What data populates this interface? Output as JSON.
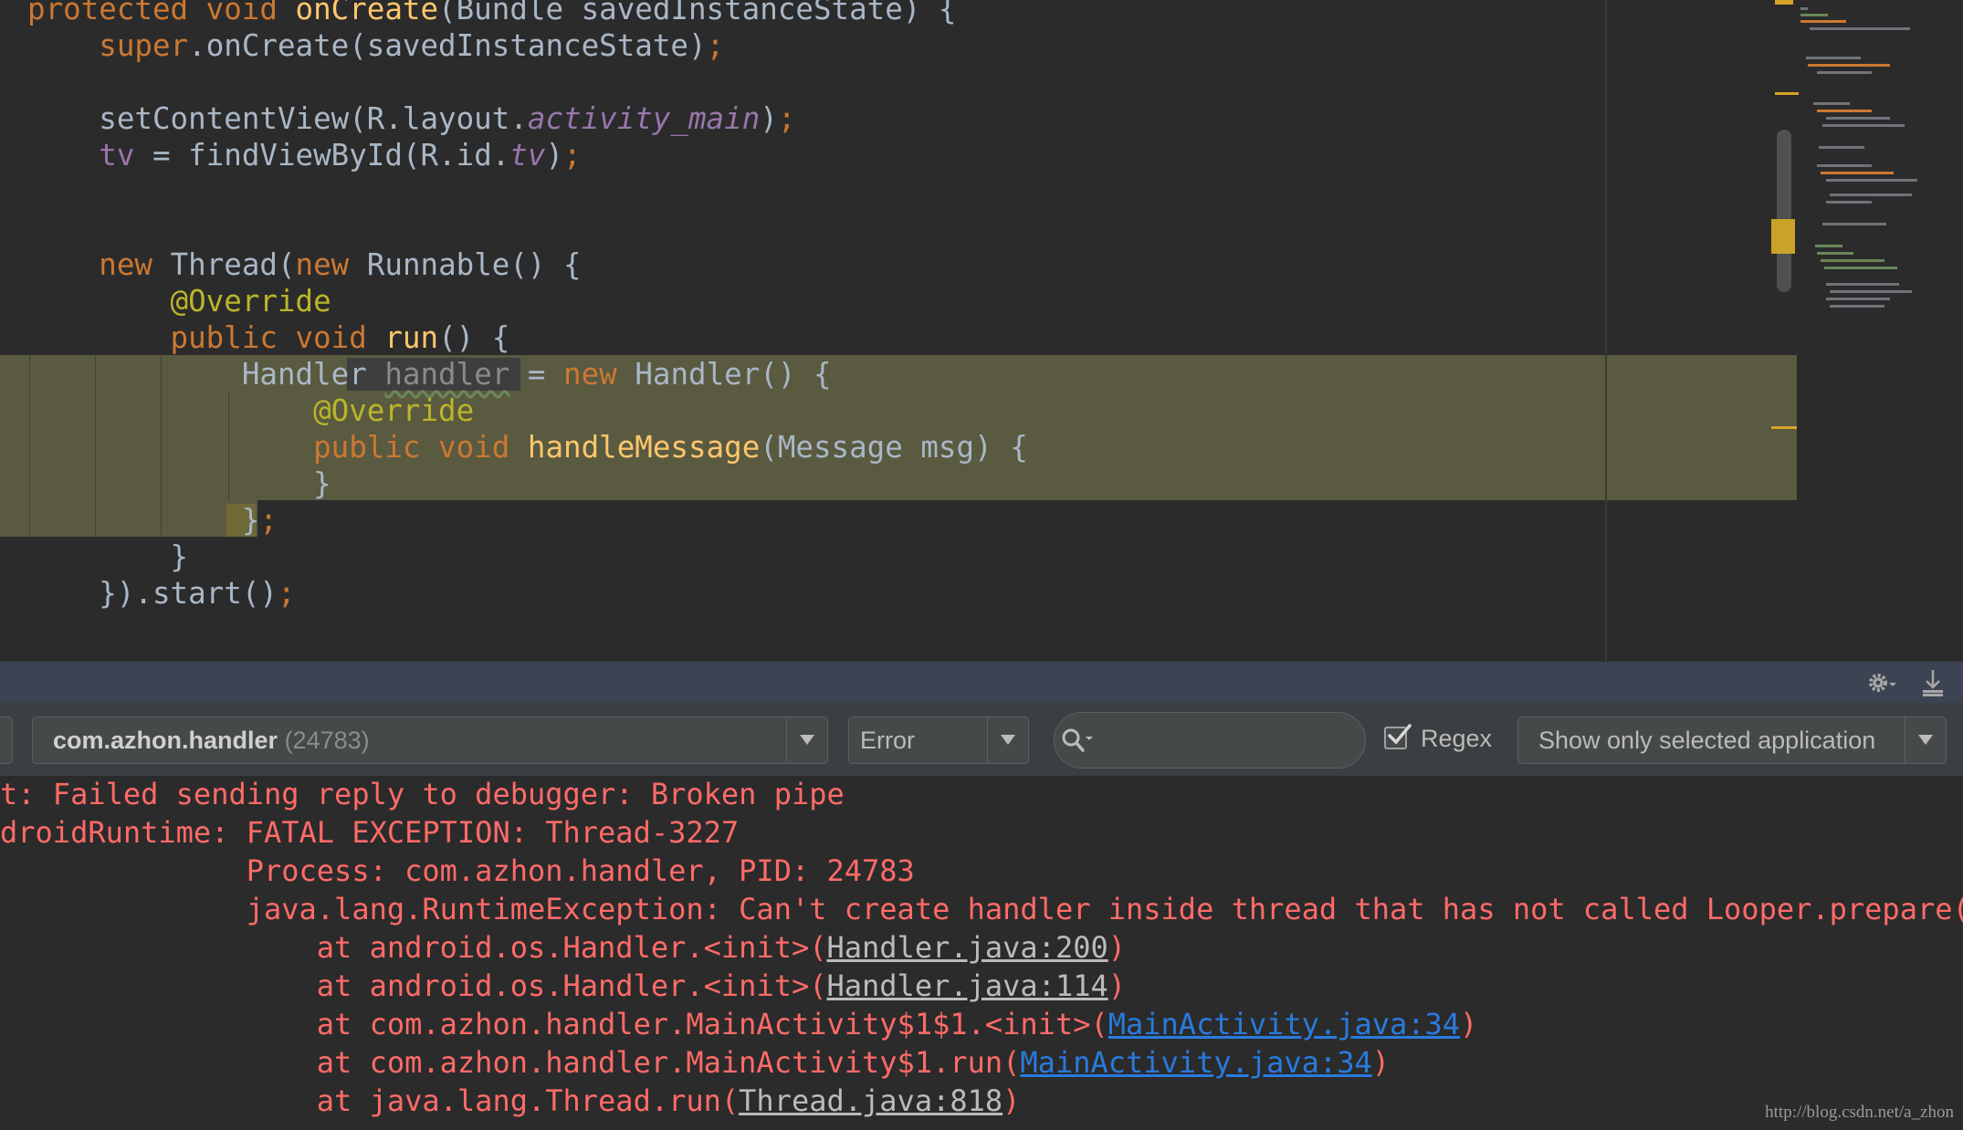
{
  "editor": {
    "lines": [
      {
        "indent": "",
        "tokens": [
          {
            "t": "protected void ",
            "c": "kw"
          },
          {
            "t": "onCreate",
            "c": "fn"
          },
          {
            "t": "(Bundle savedInstanceState) {",
            "c": ""
          }
        ]
      },
      {
        "indent": "    ",
        "tokens": [
          {
            "t": "super",
            "c": "kw"
          },
          {
            "t": ".onCreate(savedInstanceState)",
            "c": ""
          },
          {
            "t": ";",
            "c": "kw"
          }
        ]
      },
      {
        "indent": "",
        "tokens": []
      },
      {
        "indent": "    ",
        "tokens": [
          {
            "t": "setContentView(R.layout.",
            "c": ""
          },
          {
            "t": "activity_main",
            "c": "it"
          },
          {
            "t": ")",
            "c": ""
          },
          {
            "t": ";",
            "c": "kw"
          }
        ]
      },
      {
        "indent": "    ",
        "tokens": [
          {
            "t": "tv",
            "c": "fld"
          },
          {
            "t": " = findViewById(R.id.",
            "c": ""
          },
          {
            "t": "tv",
            "c": "it"
          },
          {
            "t": ")",
            "c": ""
          },
          {
            "t": ";",
            "c": "kw"
          }
        ]
      },
      {
        "indent": "",
        "tokens": []
      },
      {
        "indent": "",
        "tokens": []
      },
      {
        "indent": "    ",
        "tokens": [
          {
            "t": "new ",
            "c": "kw"
          },
          {
            "t": "Thread(",
            "c": ""
          },
          {
            "t": "new ",
            "c": "kw"
          },
          {
            "t": "Runnable() {",
            "c": ""
          }
        ]
      },
      {
        "indent": "        ",
        "tokens": [
          {
            "t": "@Override",
            "c": "an"
          }
        ]
      },
      {
        "indent": "        ",
        "tokens": [
          {
            "t": "public void ",
            "c": "kw"
          },
          {
            "t": "run",
            "c": "fn"
          },
          {
            "t": "() {",
            "c": ""
          }
        ]
      },
      {
        "indent": "            ",
        "tokens": [
          {
            "t": "Handler ",
            "c": ""
          },
          {
            "t": "handler",
            "c": "unused"
          },
          {
            "t": " = ",
            "c": ""
          },
          {
            "t": "new ",
            "c": "kw"
          },
          {
            "t": "Handler() {",
            "c": ""
          }
        ]
      },
      {
        "indent": "                ",
        "tokens": [
          {
            "t": "@Override",
            "c": "an"
          }
        ]
      },
      {
        "indent": "                ",
        "tokens": [
          {
            "t": "public void ",
            "c": "kw"
          },
          {
            "t": "handleMessage",
            "c": "fn"
          },
          {
            "t": "(Message msg) {",
            "c": ""
          }
        ]
      },
      {
        "indent": "                ",
        "tokens": [
          {
            "t": "}",
            "c": ""
          }
        ]
      },
      {
        "indent": "            ",
        "tokens": [
          {
            "t": "}",
            "c": ""
          },
          {
            "t": ";",
            "c": "kw"
          }
        ]
      },
      {
        "indent": "        ",
        "tokens": [
          {
            "t": "}",
            "c": ""
          }
        ]
      },
      {
        "indent": "    ",
        "tokens": [
          {
            "t": "}).start()",
            "c": ""
          },
          {
            "t": ";",
            "c": "kw"
          }
        ]
      }
    ]
  },
  "logcat": {
    "process_name": "com.azhon.handler",
    "process_pid": "(24783)",
    "level": "Error",
    "search_value": "",
    "regex_label": "Regex",
    "regex_checked": true,
    "filter_option": "Show only selected application",
    "output": [
      {
        "indent": "",
        "tokens": [
          {
            "t": "t: Failed sending reply to debugger: Broken pipe",
            "c": ""
          }
        ]
      },
      {
        "indent": "",
        "tokens": [
          {
            "t": "droidRuntime: FATAL EXCEPTION: Thread-3227",
            "c": ""
          }
        ]
      },
      {
        "indent": "              ",
        "tokens": [
          {
            "t": "Process: com.azhon.handler, PID: 24783",
            "c": ""
          }
        ]
      },
      {
        "indent": "              ",
        "tokens": [
          {
            "t": "java.lang.RuntimeException: Can't create handler inside thread that has not called Looper.prepare()",
            "c": ""
          }
        ]
      },
      {
        "indent": "                  ",
        "tokens": [
          {
            "t": "at android.os.Handler.<init>(",
            "c": ""
          },
          {
            "t": "Handler.java:200",
            "c": "lnk"
          },
          {
            "t": ")",
            "c": ""
          }
        ]
      },
      {
        "indent": "                  ",
        "tokens": [
          {
            "t": "at android.os.Handler.<init>(",
            "c": ""
          },
          {
            "t": "Handler.java:114",
            "c": "lnk"
          },
          {
            "t": ")",
            "c": ""
          }
        ]
      },
      {
        "indent": "                  ",
        "tokens": [
          {
            "t": "at com.azhon.handler.MainActivity$1$1.<init>(",
            "c": ""
          },
          {
            "t": "MainActivity.java:34",
            "c": "lnk-blue"
          },
          {
            "t": ")",
            "c": ""
          }
        ]
      },
      {
        "indent": "                  ",
        "tokens": [
          {
            "t": "at com.azhon.handler.MainActivity$1.run(",
            "c": ""
          },
          {
            "t": "MainActivity.java:34",
            "c": "lnk-blue"
          },
          {
            "t": ")",
            "c": ""
          }
        ]
      },
      {
        "indent": "                  ",
        "tokens": [
          {
            "t": "at java.lang.Thread.run(",
            "c": ""
          },
          {
            "t": "Thread.java:818",
            "c": "lnk"
          },
          {
            "t": ")",
            "c": ""
          }
        ]
      }
    ]
  },
  "icons": {
    "settings": "gear-icon",
    "scroll_to_end": "download-arrow-icon",
    "search": "search-icon",
    "checkbox": "checkmark-icon"
  },
  "colors": {
    "editor_bg": "#2b2b2b",
    "keyword": "#cc7832",
    "function": "#ffc66d",
    "annotation": "#bbb529",
    "field": "#9876aa",
    "default_text": "#a9b7c6",
    "highlight_bg": "#5a5a40",
    "error_text": "#ff6b68",
    "link_blue": "#287bde"
  },
  "watermark": "http://blog.csdn.net/a_zhon"
}
